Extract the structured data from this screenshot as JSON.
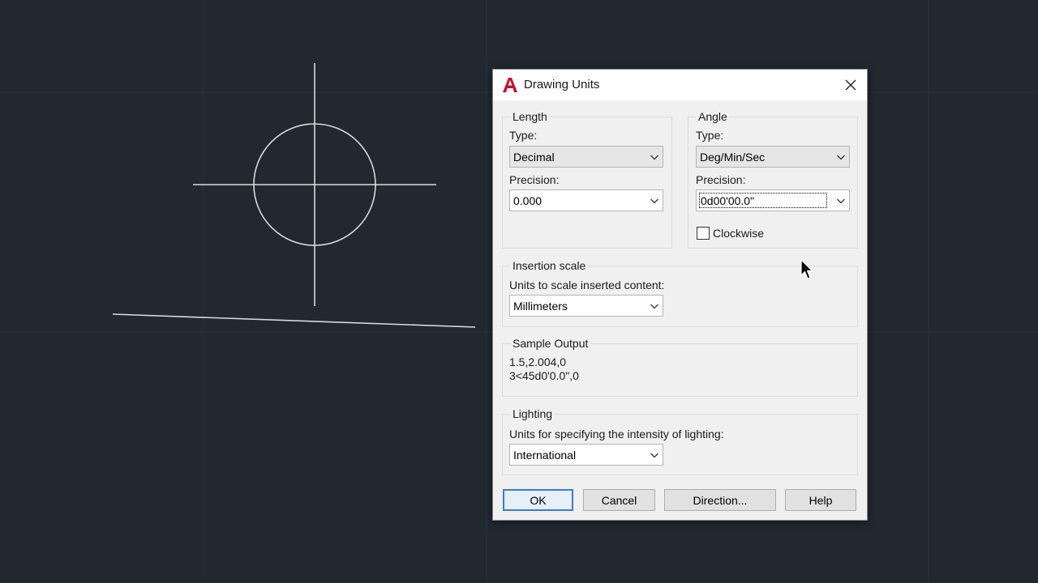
{
  "dialog": {
    "title": "Drawing Units",
    "length": {
      "group_title": "Length",
      "type_label": "Type:",
      "type_value": "Decimal",
      "precision_label": "Precision:",
      "precision_value": "0.000"
    },
    "angle": {
      "group_title": "Angle",
      "type_label": "Type:",
      "type_value": "Deg/Min/Sec",
      "precision_label": "Precision:",
      "precision_value": "0d00'00.0\"",
      "clockwise_label": "Clockwise",
      "clockwise_checked": false
    },
    "insertion": {
      "group_title": "Insertion scale",
      "label": "Units to scale inserted content:",
      "value": "Millimeters"
    },
    "sample": {
      "group_title": "Sample Output",
      "line1": "1.5,2.004,0",
      "line2": "3<45d0'0.0\",0"
    },
    "lighting": {
      "group_title": "Lighting",
      "label": "Units for specifying the intensity of lighting:",
      "value": "International"
    },
    "buttons": {
      "ok": "OK",
      "cancel": "Cancel",
      "direction": "Direction...",
      "help": "Help"
    }
  },
  "colors": {
    "canvas_bg": "#212830",
    "dialog_bg": "#f0f0f0",
    "brand_red": "#c8102e",
    "focus_blue": "#3a7bd5"
  }
}
